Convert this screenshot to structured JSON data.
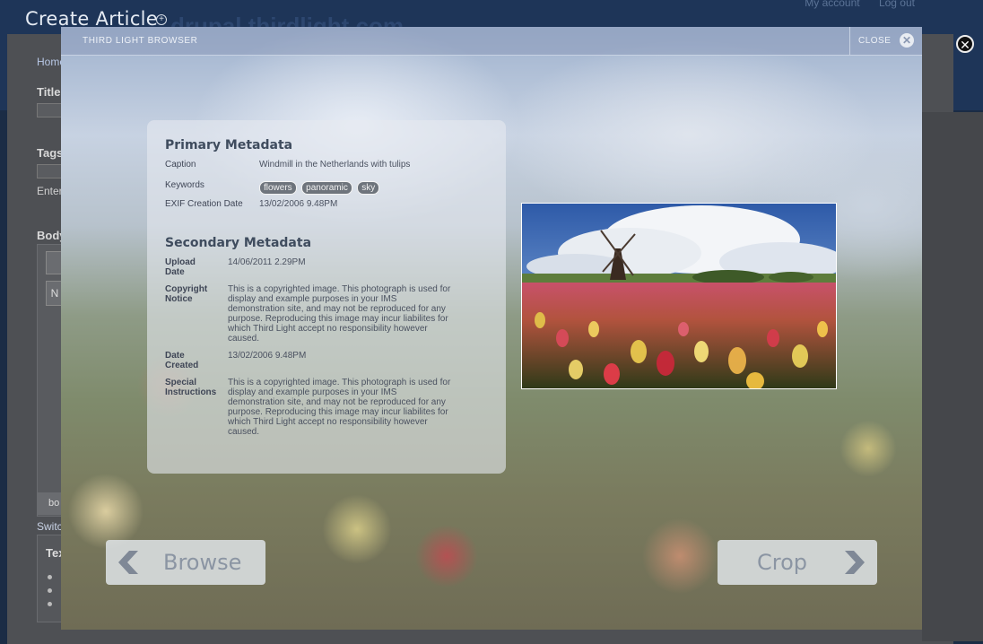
{
  "page": {
    "title": "Create Article",
    "site_name": "drupal.thirdlight.com",
    "nav": {
      "account": "My account",
      "logout": "Log out"
    }
  },
  "form": {
    "breadcrumb": "Home",
    "title_label": "Title",
    "tags_label": "Tags",
    "tags_hint": "Enter",
    "body_label": "Body",
    "editor_btn": "N",
    "editor_status": "bo",
    "switch_link": "Switc",
    "text_format_label": "Tex"
  },
  "modal": {
    "title": "THIRD LIGHT BROWSER",
    "close_label": "CLOSE",
    "primary": {
      "heading": "Primary Metadata",
      "caption_label": "Caption",
      "caption_value": "Windmill in the Netherlands with tulips",
      "keywords_label": "Keywords",
      "keywords": [
        "flowers",
        "panoramic",
        "sky"
      ],
      "exif_label": "EXIF Creation Date",
      "exif_value": "13/02/2006 9.48PM"
    },
    "secondary": {
      "heading": "Secondary Metadata",
      "upload_label_1": "Upload",
      "upload_label_2": "Date",
      "upload_value": "14/06/2011 2.29PM",
      "copyright_label_1": "Copyright",
      "copyright_label_2": "Notice",
      "copyright_lines": [
        "This is a copyrighted image. This photograph is used for",
        "display and example purposes in your IMS",
        "demonstration site, and may not be reproduced for any",
        "purpose. Reproducing this image may incur liabilites for",
        "which Third Light accept no responsibility however",
        "caused."
      ],
      "created_label_1": "Date",
      "created_label_2": "Created",
      "created_value": "13/02/2006 9.48PM",
      "special_label_1": "Special",
      "special_label_2": "Instructions",
      "special_lines": [
        "This is a copyrighted image. This photograph is used for",
        "display and example purposes in your IMS",
        "demonstration site, and may not be reproduced for any",
        "purpose. Reproducing this image may incur liabilites for",
        "which Third Light accept no responsibility however",
        "caused."
      ]
    },
    "browse_label": "Browse",
    "crop_label": "Crop"
  }
}
